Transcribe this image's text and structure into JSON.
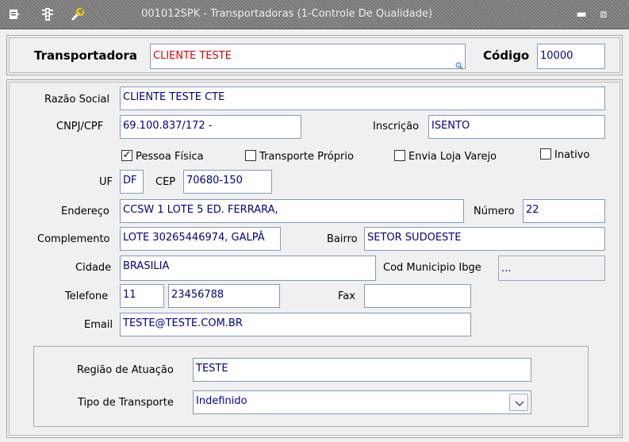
{
  "window": {
    "title": "001012SPK - Transportadoras (1-Controle De Qualidade)",
    "icons": [
      "document-icon",
      "traffic-light-icon",
      "wrench-icon"
    ],
    "minimize_glyph": "▬",
    "restore_glyph": "⧈"
  },
  "header": {
    "transportadora_label": "Transportadora",
    "transportadora_value": "CLIENTE TESTE",
    "codigo_label": "Código",
    "codigo_value": "10000"
  },
  "form": {
    "razao_social_label": "Razão Social",
    "razao_social_value": "CLIENTE TESTE CTE",
    "cnpj_label": "CNPJ/CPF",
    "cnpj_value": "69.100.837/172 -",
    "inscricao_label": "Inscrição",
    "inscricao_value": "ISENTO",
    "pessoa_fisica_label": "Pessoa Física",
    "pessoa_fisica_checked": true,
    "transporte_proprio_label": "Transporte Próprio",
    "transporte_proprio_checked": false,
    "envia_loja_label": "Envia Loja Varejo",
    "envia_loja_checked": false,
    "inativo_label": "Inativo",
    "inativo_checked": false,
    "uf_label": "UF",
    "uf_value": "DF",
    "cep_label": "CEP",
    "cep_value": "70680-150",
    "endereco_label": "Endereço",
    "endereco_value": "CCSW 1 LOTE 5 ED. FERRARA,",
    "numero_label": "Número",
    "numero_value": "22",
    "complemento_label": "Complemento",
    "complemento_value": "LOTE 30265446974, GALPÂ",
    "bairro_label": "Bairro",
    "bairro_value": "SETOR SUDOESTE",
    "cidade_label": "Cidade",
    "cidade_value": "BRASILIA",
    "cod_municipio_label": "Cod Municipio Ibge",
    "cod_municipio_value": "...",
    "telefone_label": "Telefone",
    "telefone_ddd": "11",
    "telefone_numero": "23456788",
    "fax_label": "Fax",
    "fax_value": "",
    "email_label": "Email",
    "email_value": "TESTE@TESTE.COM.BR"
  },
  "regiao": {
    "regiao_label": "Região de Atuação",
    "regiao_value": "TESTE",
    "tipo_transporte_label": "Tipo de Transporte",
    "tipo_transporte_value": "Indefinido"
  },
  "colors": {
    "field_text": "#00008b",
    "highlight_text": "#e00000",
    "field_border": "#7f9db9"
  }
}
